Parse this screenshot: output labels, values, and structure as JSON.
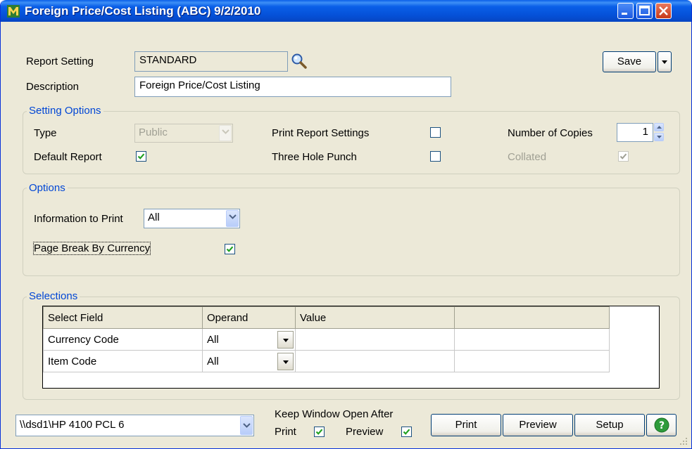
{
  "window": {
    "title": "Foreign Price/Cost Listing (ABC) 9/2/2010"
  },
  "report": {
    "setting_label": "Report Setting",
    "setting_value": "STANDARD",
    "description_label": "Description",
    "description_value": "Foreign Price/Cost Listing",
    "save_label": "Save"
  },
  "setting_options": {
    "title": "Setting Options",
    "type_label": "Type",
    "type_value": "Public",
    "default_report_label": "Default Report",
    "default_report_checked": true,
    "print_report_settings_label": "Print Report Settings",
    "print_report_settings_checked": false,
    "three_hole_punch_label": "Three Hole Punch",
    "three_hole_punch_checked": false,
    "number_of_copies_label": "Number of Copies",
    "number_of_copies_value": "1",
    "collated_label": "Collated",
    "collated_checked": true
  },
  "options": {
    "title": "Options",
    "info_to_print_label": "Information to Print",
    "info_to_print_value": "All",
    "page_break_label": "Page Break By Currency",
    "page_break_checked": true
  },
  "selections": {
    "title": "Selections",
    "columns": [
      "Select Field",
      "Operand",
      "Value",
      ""
    ],
    "rows": [
      {
        "field": "Currency Code",
        "operand": "All",
        "value": ""
      },
      {
        "field": "Item Code",
        "operand": "All",
        "value": ""
      }
    ]
  },
  "footer": {
    "printer_value": "\\\\dsd1\\HP 4100 PCL 6",
    "keep_open_label": "Keep Window Open After",
    "print_chk_label": "Print",
    "print_chk_checked": true,
    "preview_chk_label": "Preview",
    "preview_chk_checked": true,
    "print_button": "Print",
    "preview_button": "Preview",
    "setup_button": "Setup",
    "help_glyph": "?"
  },
  "colors": {
    "titlebar": "#0a5fe8",
    "group_title": "#0046d5",
    "background": "#ece9d8",
    "check": "#21a121"
  }
}
